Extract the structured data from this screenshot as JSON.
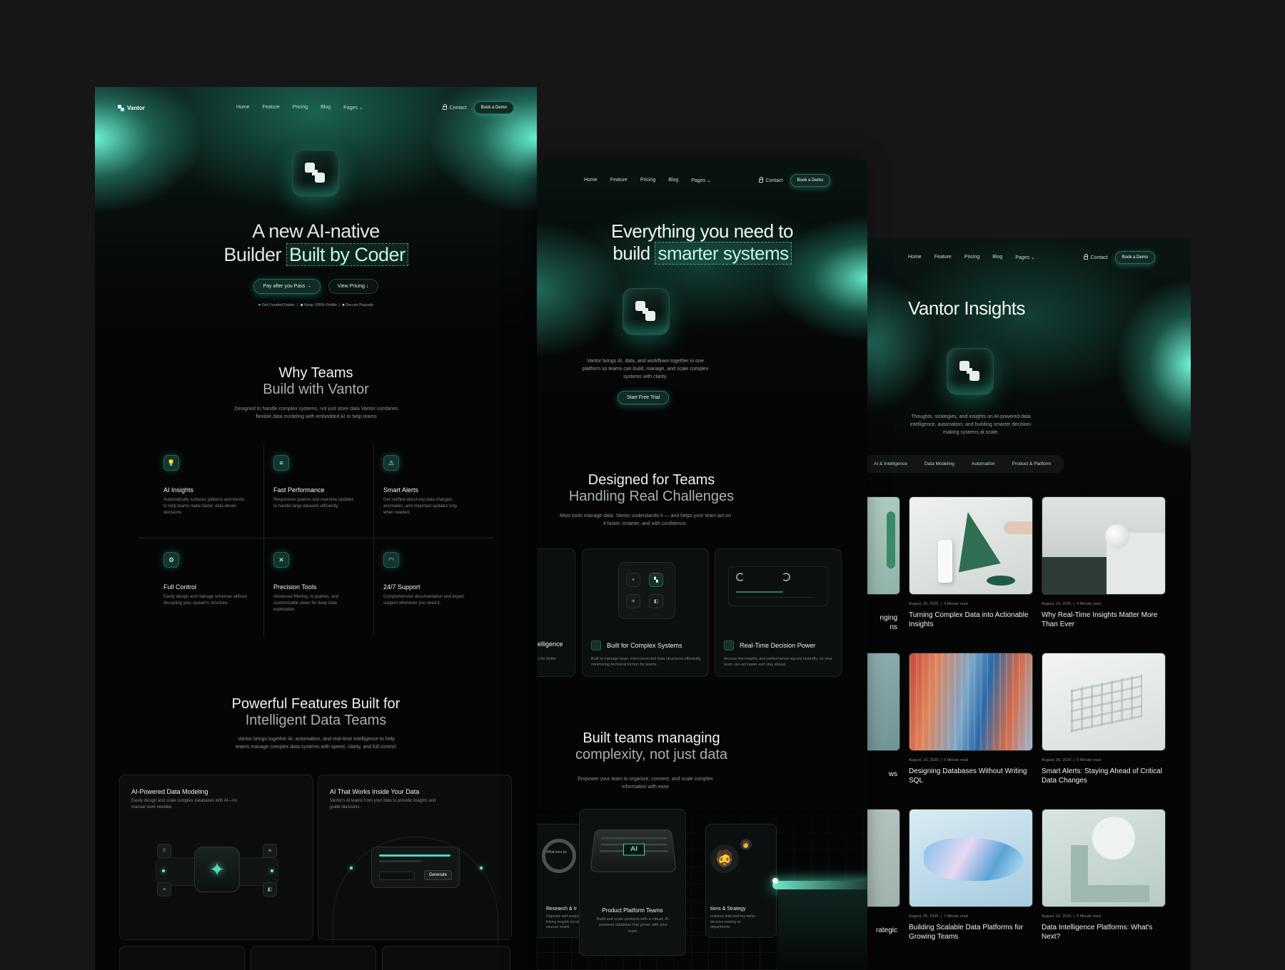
{
  "nav": {
    "brand": "Vantor",
    "links": [
      "Home",
      "Feature",
      "Pricing",
      "Blog",
      "Pages"
    ],
    "contact": "Contact",
    "demo": "Book a Demo"
  },
  "landing": {
    "hero_line1": "A new AI-native",
    "hero_line2_prefix": "Builder",
    "hero_highlight": "Built by Coder",
    "cta_primary": "Pay after you Pass",
    "cta_secondary": "View Pricing",
    "badges": [
      "Get Funded Faster",
      "Keep 100% Profits",
      "Secure Payouts"
    ],
    "why_title1": "Why Teams",
    "why_title2": "Build with Vantor",
    "why_desc": "Designed to handle complex systems, not just store data Vantor combines flexible data modeling with embedded AI to help teams",
    "features": [
      {
        "title": "AI Insights",
        "desc": "Automatically surfaces patterns and trends to help teams make faster, data-driven decisions",
        "icon": "bulb-icon"
      },
      {
        "title": "Fast Performance",
        "desc": "Responsive queries and real-time updates to handle large datasets efficiently",
        "icon": "speed-icon"
      },
      {
        "title": "Smart Alerts",
        "desc": "Get notified about key data changes, anomalies, and important updates only when needed.",
        "icon": "alert-icon"
      },
      {
        "title": "Full Control",
        "desc": "Easily design and manage schemas without disrupting your system's structure.",
        "icon": "gear-icon"
      },
      {
        "title": "Precision Tools",
        "desc": "Advanced filtering, AI queries, and customizable views for deep data exploration.",
        "icon": "tools-icon"
      },
      {
        "title": "24/7 Support",
        "desc": "Comprehensive documentation and expert support whenever you need it.",
        "icon": "headset-icon"
      }
    ],
    "powerful_title1": "Powerful Features Built for",
    "powerful_title2": "Intelligent Data Teams",
    "powerful_desc": "Vantor brings together AI, automation, and real-time intelligence to help teams manage complex data systems with speed, clarity, and full control.",
    "card1_title": "AI-Powered Data Modeling",
    "card1_desc": "Easily design and scale complex databases with AI—no manual work needed.",
    "card2_title": "AI That Works Inside Your Data",
    "card2_desc": "Vantor's AI learns from your data to provide insights and guide decisions.",
    "generate": "Generate"
  },
  "product": {
    "hero_line1": "Everything you need to",
    "hero_line2_prefix": "build",
    "hero_highlight": "smarter systems",
    "desc": "Vantor brings AI, data, and workflows together in one platform so teams can build, manage, and scale complex systems with clarity.",
    "cta": "Start Free Trial",
    "designed_title1": "Designed for Teams",
    "designed_title2": "Handling Real Challenges",
    "designed_desc": "Most tools manage data. Vantor understands it — and helps your team act on it faster, smarter, and with confidence.",
    "partial_card_title": "elligence",
    "partial_card_desc": "s for better",
    "card_complex_title": "Built for Complex Systems",
    "card_complex_desc": "Built to manage large, interconnected data structures efficiently, minimizing technical friction for teams.",
    "card_realtime_title": "Real-Time Decision Power",
    "card_realtime_desc": "Access live insights and performance signals instantly, so your team can act faster and stay ahead.",
    "managing_title1": "Built teams managing",
    "managing_title2": "complexity, not just data",
    "managing_desc": "Empower your team to organize, connect, and scale complex information with ease",
    "ai_label": "AI",
    "search_hint": "What wou",
    "search_hint_end": "ke",
    "research_title": "Research & Ir",
    "research_desc": "Organize and analyze r linking insights across sources seaml",
    "platform_title": "Product Platform Teams",
    "platform_desc": "Build and scale products with a robust, AI-powered database that grows with your team.",
    "ops_title": "tions & Strategy",
    "ops_desc": "erational data and key better decision-making ss departments"
  },
  "blog": {
    "title": "Vantor Insights",
    "desc": "Thoughts, strategies, and insights on AI-powered data intelligence, automation, and building smarter decision-making systems at scale.",
    "tabs": [
      "AI & Intelligence",
      "Data Modeling",
      "Automation",
      "Product & Platform"
    ],
    "partial_titles": [
      "nging",
      "ns",
      "ws",
      "rategic"
    ],
    "posts": [
      {
        "date": "August, 26, 2025",
        "read": "4 Minute read",
        "title": "Turning Complex Data into Actionable Insights"
      },
      {
        "date": "August, 24, 2025",
        "read": "4 Minute read",
        "title": "Why Real-Time Insights Matter More Than Ever"
      },
      {
        "date": "August, 10, 2025",
        "read": "5 Minute read",
        "title": "Designing Databases Without Writing SQL"
      },
      {
        "date": "August, 09, 2025",
        "read": "6 Minute read",
        "title": "Smart Alerts: Staying Ahead of Critical Data Changes"
      },
      {
        "date": "August, 05, 2025",
        "read": "7 Minute read",
        "title": "Building Scalable Data Platforms for Growing Teams"
      },
      {
        "date": "August, 01, 2025",
        "read": "6 Minute read",
        "title": "Data Intelligence Platforms: What's Next?"
      }
    ]
  },
  "colors": {
    "accent": "#6fe8c9",
    "background": "#050505",
    "page": "#161616"
  }
}
